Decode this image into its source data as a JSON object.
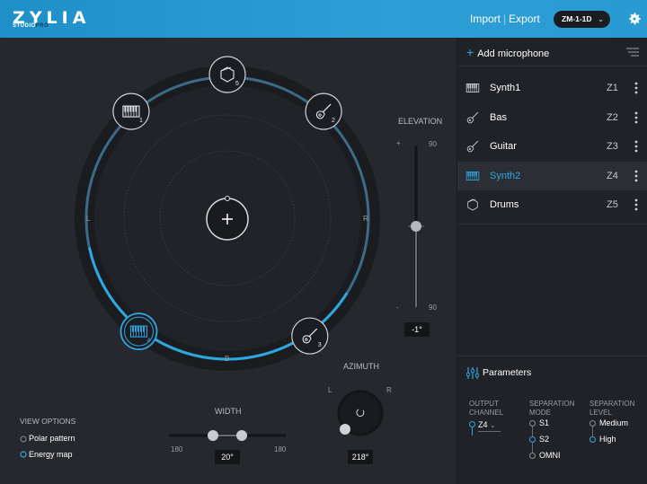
{
  "header": {
    "logo": "ZYLIA",
    "logo_sub_a": "STUDIO",
    "logo_sub_b": "PRO",
    "import_label": "Import",
    "export_label": "Export",
    "device": "ZM-1-1D",
    "colors": {
      "accent": "#2ea7e0",
      "header_start": "#1f8fc7",
      "header_end": "#2a9ad2"
    }
  },
  "stage": {
    "center_icon": "plus-icon",
    "labels": {
      "left": "L",
      "right": "R",
      "back": "B"
    },
    "sources": [
      {
        "id": "5",
        "icon": "drum-icon",
        "azimuth_deg": 0,
        "selected": false
      },
      {
        "id": "1",
        "icon": "keyboard-icon",
        "azimuth_deg": -42,
        "selected": false
      },
      {
        "id": "2",
        "icon": "guitar-icon",
        "azimuth_deg": 42,
        "selected": false
      },
      {
        "id": "4",
        "icon": "keyboard-icon",
        "azimuth_deg": 218,
        "selected": true
      },
      {
        "id": "3",
        "icon": "guitar-icon",
        "azimuth_deg": 145,
        "selected": false
      }
    ]
  },
  "elevation": {
    "label": "ELEVATION",
    "top_value": "90",
    "bottom_value": "90",
    "plus": "+",
    "minus": "-",
    "value": "-1°"
  },
  "azimuth": {
    "label": "AZIMUTH",
    "left": "L",
    "right": "R",
    "value": "218°"
  },
  "width": {
    "label": "WIDTH",
    "min": "180",
    "max": "180",
    "value": "20°"
  },
  "view_options": {
    "title": "VIEW OPTIONS",
    "options": [
      {
        "label": "Polar pattern",
        "selected": false
      },
      {
        "label": "Energy map",
        "selected": true
      }
    ]
  },
  "sidebar": {
    "add_label": "Add microphone",
    "tracks": [
      {
        "name": "Synth1",
        "channel": "Z1",
        "icon": "keyboard-icon",
        "selected": false
      },
      {
        "name": "Bas",
        "channel": "Z2",
        "icon": "guitar-icon",
        "selected": false
      },
      {
        "name": "Guitar",
        "channel": "Z3",
        "icon": "guitar-icon",
        "selected": false
      },
      {
        "name": "Synth2",
        "channel": "Z4",
        "icon": "keyboard-icon",
        "selected": true
      },
      {
        "name": "Drums",
        "channel": "Z5",
        "icon": "drum-icon",
        "selected": false
      }
    ]
  },
  "parameters": {
    "title": "Parameters",
    "output_channel": {
      "label_a": "OUTPUT",
      "label_b": "CHANNEL",
      "value": "Z4"
    },
    "separation_mode": {
      "label_a": "SEPARATION",
      "label_b": "MODE",
      "options": [
        "S1",
        "S2",
        "OMNI"
      ],
      "selected": "S2"
    },
    "separation_level": {
      "label_a": "SEPARATION",
      "label_b": "LEVEL",
      "options": [
        "Medium",
        "High"
      ],
      "selected": "High"
    }
  }
}
